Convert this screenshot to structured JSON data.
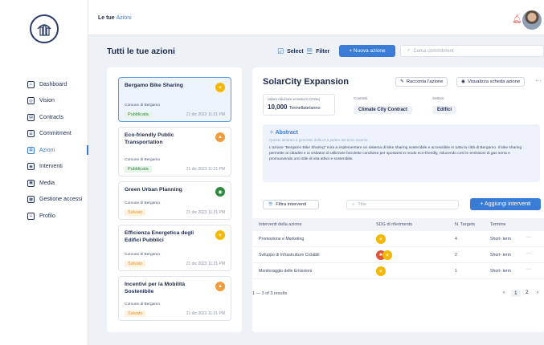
{
  "app": {
    "top_title_prefix": "Le tue",
    "top_title_accent": "Azioni"
  },
  "sidebar": {
    "items": [
      {
        "label": "Dashboard",
        "icon": "⌂"
      },
      {
        "label": "Vision",
        "icon": "◎"
      },
      {
        "label": "Contracts",
        "icon": "▤"
      },
      {
        "label": "Commitment",
        "icon": "☰"
      },
      {
        "label": "Azioni",
        "icon": "▦",
        "active": true
      },
      {
        "label": "Interventi",
        "icon": "◉"
      },
      {
        "label": "Media",
        "icon": "▣"
      },
      {
        "label": "Gestione accessi",
        "icon": "▩"
      },
      {
        "label": "Profilo",
        "icon": "☺"
      }
    ]
  },
  "header": {
    "page_title": "Tutti le tue azioni",
    "select_label": "Select",
    "filter_label": "Filter",
    "new_action_label": "+ Nuova azione",
    "search_placeholder": "Cerca commitment"
  },
  "cards": [
    {
      "title": "Bergamo Bike Sharing",
      "org": "Comune di Bergamo",
      "status": "Pubblicata",
      "status_kind": "pub",
      "date": "21 dic 2023 11:21 PM",
      "badge_color": "#f5b700",
      "badge_icon": "☀"
    },
    {
      "title": "Eco-friendly Public Transportation",
      "org": "Comune di Bergamo",
      "status": "Pubblicata",
      "status_kind": "pub",
      "date": "21 dic 2023 11:21 PM",
      "badge_color": "#f29b38",
      "badge_icon": "▲"
    },
    {
      "title": "Green Urban Planning",
      "org": "Comune di Bergamo",
      "status": "Salvato",
      "status_kind": "sav",
      "date": "21 dic 2023 11:21 PM",
      "badge_color": "#2f8a3e",
      "badge_icon": "◉"
    },
    {
      "title": "Efficienza Energetica degli Edifici Pubblici",
      "org": "Comune di Bergamo",
      "status": "Salvato",
      "status_kind": "sav",
      "date": "21 dic 2023 11:21 PM",
      "badge_color": "#f5b700",
      "badge_icon": "☀"
    },
    {
      "title": "Incentivi per la Mobilità Sostenibile",
      "org": "Comune di Bergamo",
      "status": "Salvato",
      "status_kind": "sav",
      "date": "21 dic 2023 11:21 PM",
      "badge_color": "#f29b38",
      "badge_icon": "▲"
    }
  ],
  "detail": {
    "title": "SolarCity Expansion",
    "tell_label": "Racconta l'azione",
    "view_label": "Visualizza scheda azione",
    "metric_label": "Valore riduzione emissioni CO2eq",
    "metric_value": "10,000",
    "metric_unit": "Tonnellate/anno",
    "contract_label": "Contratti",
    "contract_value": "Climate City Contract",
    "sector_label": "Settore",
    "sector_value": "Edifici",
    "abstract_title": "Abstract",
    "abstract_sub": "Questo abstract è generato dalla AI a partire dal testo inserito",
    "abstract_text": "L'azione \"Bergamo Bike Sharing\" mira a implementare un sistema di bike sharing sostenibile e accessibile in tutta la città di Bergamo. Il bike sharing permette ai cittadini e ai visitatori di utilizzare biciclette condivise per spostarsi in modo eco-friendly, riducendo così le emissioni di gas serra e promuovendo uno stile di vita attivo e sostenibile.",
    "filter_label": "Filtra interventi",
    "title_placeholder": "Title",
    "add_label": "+ Aggiungi interventi",
    "columns": [
      "Interventi della azione",
      "SDG di riferimento",
      "N. Targets",
      "Termine"
    ],
    "rows": [
      {
        "name": "Promozione e Marketing",
        "targets": "4",
        "term": "Short- term",
        "sdgs": [
          {
            "color": "#f5b700",
            "icon": "☀"
          }
        ]
      },
      {
        "name": "Sviluppo di Infrastrutture Ciclabili",
        "targets": "2",
        "term": "Short- term",
        "sdgs": [
          {
            "color": "#e2543a",
            "icon": "♣"
          },
          {
            "color": "#f5b700",
            "icon": "☀"
          }
        ]
      },
      {
        "name": "Monitoraggio delle Emissioni",
        "targets": "1",
        "term": "Short- term",
        "sdgs": [
          {
            "color": "#f5b700",
            "icon": "☀"
          }
        ]
      }
    ],
    "results": "1 — 3 of 3 results",
    "pages": [
      "1",
      "2"
    ],
    "current_page": "1"
  }
}
